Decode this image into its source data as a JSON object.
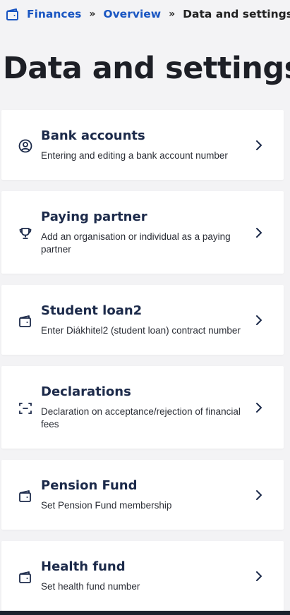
{
  "breadcrumb": {
    "items": [
      {
        "label": "Finances",
        "link": true
      },
      {
        "label": "Overview",
        "link": true
      },
      {
        "label": "Data and settings",
        "link": false
      }
    ],
    "separator": "»"
  },
  "page": {
    "title": "Data and settings"
  },
  "cards": [
    {
      "title": "Bank accounts",
      "description": "Entering and editing a bank account number",
      "icon": "user-circle-icon"
    },
    {
      "title": "Paying partner",
      "description": "Add an organisation or individual as a paying partner",
      "icon": "trophy-icon"
    },
    {
      "title": "Student loan2",
      "description": "Enter Diákhitel2 (student loan) contract number",
      "icon": "wallet-icon"
    },
    {
      "title": "Declarations",
      "description": "Declaration on acceptance/rejection of financial fees",
      "icon": "scan-frame-icon"
    },
    {
      "title": "Pension Fund",
      "description": "Set Pension Fund membership",
      "icon": "wallet-icon"
    },
    {
      "title": "Health fund",
      "description": "Set health fund number",
      "icon": "wallet-icon"
    }
  ],
  "colors": {
    "link": "#1a56c2",
    "card_title": "#1c2a4a",
    "background": "#f3f3f5"
  }
}
